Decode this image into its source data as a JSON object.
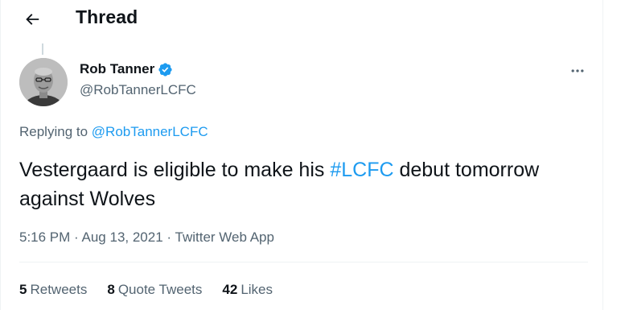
{
  "header": {
    "back_icon": "arrow-left-icon",
    "title": "Thread"
  },
  "author": {
    "name": "Rob Tanner",
    "handle": "@RobTannerLCFC",
    "verified_icon": "verified-badge-icon",
    "verified_color": "#1d9bf0"
  },
  "more_icon": "more-horizontal-icon",
  "replying": {
    "prefix": "Replying to",
    "handle": "@RobTannerLCFC"
  },
  "tweet": {
    "text_before": "Vestergaard is eligible to make his ",
    "hashtag": "#LCFC",
    "text_after": " debut tomorrow against Wolves"
  },
  "meta": {
    "time": "5:16 PM",
    "sep1": "·",
    "date": "Aug 13, 2021",
    "sep2": "·",
    "source": "Twitter Web App"
  },
  "stats": {
    "retweets_count": "5",
    "retweets_label": "Retweets",
    "quotes_count": "8",
    "quotes_label": "Quote Tweets",
    "likes_count": "42",
    "likes_label": "Likes"
  },
  "colors": {
    "accent": "#1d9bf0",
    "text": "#0f1419",
    "muted": "#536471"
  }
}
